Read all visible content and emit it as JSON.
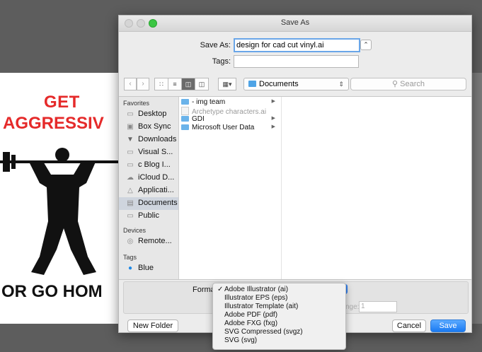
{
  "poster": {
    "line1": "GET",
    "line2": "AGGRESSIV",
    "line3": "OR GO HOM"
  },
  "dialog": {
    "title": "Save As",
    "save_as_label": "Save As:",
    "save_as_value": "design for cad cut vinyl.ai",
    "tags_label": "Tags:",
    "tags_value": ""
  },
  "toolbar": {
    "location": "Documents",
    "search_placeholder": "Search"
  },
  "sidebar": {
    "favorites_header": "Favorites",
    "devices_header": "Devices",
    "tags_header": "Tags",
    "items": [
      {
        "label": "Desktop",
        "icon": "desktop-icon"
      },
      {
        "label": "Box Sync",
        "icon": "box-icon"
      },
      {
        "label": "Downloads",
        "icon": "downloads-icon"
      },
      {
        "label": "Visual S...",
        "icon": "folder-icon"
      },
      {
        "label": "c Blog I...",
        "icon": "folder-icon"
      },
      {
        "label": "iCloud D...",
        "icon": "cloud-icon"
      },
      {
        "label": "Applicati...",
        "icon": "applications-icon"
      },
      {
        "label": "Documents",
        "icon": "documents-icon"
      },
      {
        "label": "Public",
        "icon": "folder-icon"
      }
    ],
    "devices": [
      {
        "label": "Remote...",
        "icon": "disc-icon"
      }
    ],
    "tags": [
      {
        "label": "Blue",
        "color": "#1e88e5"
      }
    ]
  },
  "files": [
    {
      "name": "- img team",
      "type": "folder",
      "has_children": true
    },
    {
      "name": "Archetype characters.ai",
      "type": "file",
      "has_children": false
    },
    {
      "name": "GDI",
      "type": "folder",
      "has_children": true
    },
    {
      "name": "Microsoft User Data",
      "type": "folder",
      "has_children": true
    }
  ],
  "options": {
    "format_label": "Format",
    "range_label": "nge:",
    "range_value": "1"
  },
  "format_menu": {
    "items": [
      {
        "label": "Adobe Illustrator (ai)",
        "checked": true
      },
      {
        "label": "Illustrator EPS (eps)",
        "checked": false
      },
      {
        "label": "Illustrator Template (ait)",
        "checked": false
      },
      {
        "label": "Adobe PDF (pdf)",
        "checked": false
      },
      {
        "label": "Adobe FXG (fxg)",
        "checked": false
      },
      {
        "label": "SVG Compressed (svgz)",
        "checked": false
      },
      {
        "label": "SVG (svg)",
        "checked": false
      }
    ]
  },
  "buttons": {
    "new_folder": "New Folder",
    "cancel": "Cancel",
    "save": "Save"
  }
}
